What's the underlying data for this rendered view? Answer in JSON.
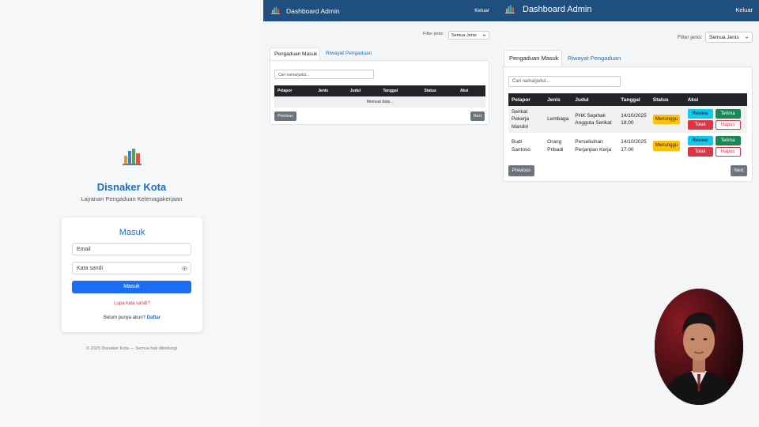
{
  "login": {
    "brand": "Disnaker Kota",
    "tagline": "Layanan Pengaduan Ketenagakerjaan",
    "card_title": "Masuk",
    "email_placeholder": "Email",
    "password_placeholder": "Kata sandi",
    "submit_label": "Masuk",
    "forgot_label": "Lupa kata sandi?",
    "no_account_text": "Belum punya akun?",
    "register_label": "Daftar",
    "footer": "© 2025 Disnaker Kota — Semua hak dilindungi"
  },
  "admin_small": {
    "title": "Dashboard Admin",
    "logout_label": "Keluar",
    "filter_label": "Filter jenis:",
    "filter_value": "Semua Jenis",
    "tabs": [
      "Pengaduan Masuk",
      "Riwayat Pengaduan"
    ],
    "search_placeholder": "Cari nama/judul...",
    "columns": [
      "Pelapor",
      "Jenis",
      "Judul",
      "Tanggal",
      "Status",
      "Aksi"
    ],
    "loading_text": "Memuat data...",
    "prev_label": "Previous",
    "next_label": "Next"
  },
  "admin_large": {
    "title": "Dashboard Admin",
    "logout_label": "Keluar",
    "filter_label": "Filter jenis:",
    "filter_value": "Semua Jenis",
    "tabs": [
      "Pengaduan Masuk",
      "Riwayat Pengaduan"
    ],
    "search_placeholder": "Cari nama/judul...",
    "columns": [
      "Pelapor",
      "Jenis",
      "Judul",
      "Tanggal",
      "Status",
      "Aksi"
    ],
    "rows": [
      {
        "pelapor": "Serikat Pekerja Mandiri",
        "jenis": "Lembaga",
        "judul": "PHK Sepihak Anggota Serikat",
        "tanggal": "14/10/2025 18.00",
        "status": "Menunggu"
      },
      {
        "pelapor": "Budi Santoso",
        "jenis": "Orang Pribadi",
        "judul": "Perselisihan Perjanjian Kerja",
        "tanggal": "14/10/2025 17.00",
        "status": "Menunggu"
      }
    ],
    "actions": {
      "review": "Review",
      "accept": "Terima",
      "reject": "Tolak",
      "delete": "Hapus"
    },
    "prev_label": "Previous",
    "next_label": "Next"
  },
  "colors": {
    "navbar": "#1f4f7e",
    "primary": "#1b6ef3",
    "brand_text": "#1e6fc0",
    "status_pending": "#ffc107",
    "table_header": "#212529"
  }
}
